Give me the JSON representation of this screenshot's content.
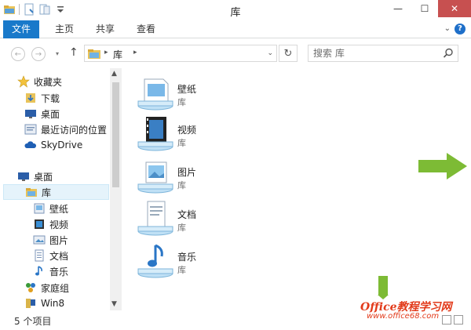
{
  "window": {
    "title": "库",
    "minimize_glyph": "—",
    "maximize_glyph": "☐",
    "close_glyph": "✕"
  },
  "ribbon": {
    "tabs": [
      "文件",
      "主页",
      "共享",
      "查看"
    ],
    "expand_glyph": "⌄",
    "help_glyph": "?"
  },
  "address": {
    "crumbs": [
      "库"
    ],
    "back_glyph": "←",
    "forward_glyph": "→",
    "recent_glyph": "▾",
    "up_glyph": "↑",
    "dropdown_glyph": "⌄",
    "refresh_glyph": "↻"
  },
  "search": {
    "placeholder": "搜索 库"
  },
  "navigation": {
    "favorites_header": "收藏夹",
    "favorites": [
      "下载",
      "桌面",
      "最近访问的位置"
    ],
    "skydrive": "SkyDrive",
    "desktop": "桌面",
    "libraries": "库",
    "library_children": [
      "壁纸",
      "视频",
      "图片",
      "文档",
      "音乐"
    ],
    "homegroup": "家庭组",
    "computer": "Win8"
  },
  "libraries": [
    {
      "name": "壁纸",
      "type": "库",
      "icon": "wallpaper-library-icon"
    },
    {
      "name": "视频",
      "type": "库",
      "icon": "video-library-icon"
    },
    {
      "name": "图片",
      "type": "库",
      "icon": "pictures-library-icon"
    },
    {
      "name": "文档",
      "type": "库",
      "icon": "documents-library-icon"
    },
    {
      "name": "音乐",
      "type": "库",
      "icon": "music-library-icon"
    }
  ],
  "status": {
    "item_count": "5 个项目"
  },
  "watermark": {
    "brand": "Office教程学习网",
    "url": "www.office68.com"
  },
  "colors": {
    "accent": "#1979ca",
    "close": "#c75050",
    "arrow": "#7dbb35",
    "watermark": "#e23a1a",
    "selection": "#e5f3fb"
  }
}
